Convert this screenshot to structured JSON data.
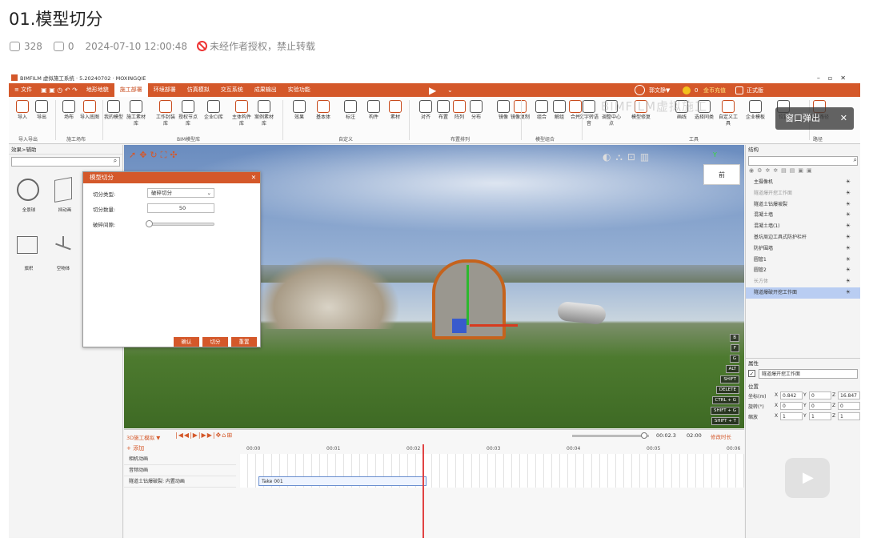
{
  "page": {
    "title": "01.模型切分",
    "views": "328",
    "comments": "0",
    "datetime": "2024-07-10 12:00:48",
    "notice": "未经作者授权，禁止转载"
  },
  "app": {
    "title": "BIMFILM 虚拟施工系统 · 5.20240702 · MOXINGQIE",
    "file_menu": "≡ 文件",
    "tabs": [
      "地形地貌",
      "施工部署",
      "环境部署",
      "仿真模拟",
      "交互系统",
      "成果输出",
      "实验功能"
    ],
    "active_tab": "施工部署",
    "user": "郭文静▼",
    "coins": "0",
    "recharge": "金币充值",
    "edition": "正式版"
  },
  "ribbon": {
    "buttons": [
      "导入",
      "导出",
      "场布",
      "导入底图",
      "我的模型",
      "施工素材库",
      "工作封装库",
      "授权节点库",
      "企业CI库",
      "主体构件库",
      "案例素材库",
      "效果",
      "基本体",
      "标注",
      "构件",
      "素材",
      "对齐",
      "布置",
      "阵列",
      "分布",
      "镜像",
      "镜像复制",
      "组合",
      "解组",
      "合并",
      "文字转语音",
      "调整中心点",
      "模型修复",
      "画线",
      "选择同类",
      "自定义工具",
      "企业模板",
      "位置",
      "测量路径"
    ],
    "groups": [
      "导入导出",
      "施工场布",
      "BIM模型库",
      "自定义",
      "布置排列",
      "模型组合",
      "工具",
      "路径"
    ]
  },
  "left_panel": {
    "header": "效果>辅助",
    "items": [
      "全景球",
      "挡动画",
      "旗帜",
      "空物体"
    ]
  },
  "dialog": {
    "title": "模型切分",
    "type_label": "切分类型:",
    "type_value": "破碎切分",
    "count_label": "切分数量:",
    "count_value": "50",
    "gap_label": "破碎间隙:",
    "gap_value": 0.0,
    "confirm": "确认",
    "split": "切分",
    "reset": "重置"
  },
  "overlay": {
    "popout": "窗口弹出",
    "watermark": "BIMFILM虚拟施工"
  },
  "viewport": {
    "view_label": "前",
    "axis_y": "Y",
    "shortcuts": [
      "B",
      "F",
      "G",
      "ALT",
      "SHIFT",
      "DELETE",
      "CTRL + G",
      "SHIFT + G",
      "SHIFT + T"
    ]
  },
  "right_panel": {
    "header": "结构",
    "items": [
      "主摄像机",
      "隧道爆开挖工作面",
      "隧道土钻爆坡裂",
      "混凝土墙",
      "混凝土墙(1)",
      "基坑周边工具式防护栏杆",
      "防护围墙",
      "圆管1",
      "圆管2",
      "长方体",
      "隧道爆破开挖工作面"
    ],
    "selected_index": 10,
    "props_header": "属性",
    "name_value": "隧道爆开挖工作面",
    "position_header": "位置",
    "coord_label": "坐标(m)",
    "rot_label": "旋转(°)",
    "scale_label": "缩放",
    "coord": {
      "x": "0.842",
      "y": "0",
      "z": "16.847"
    },
    "rot": {
      "x": "0",
      "y": "0",
      "z": "0"
    },
    "scale": {
      "x": "1",
      "y": "1",
      "z": "1"
    }
  },
  "timeline": {
    "mode": "3D施工模拟 ▼",
    "add": "+ 添加",
    "tracks": [
      "相机动画",
      "音频动画",
      "隧道土钻爆破裂: 内置动画"
    ],
    "ticks": [
      "00:00",
      "00:01",
      "00:02",
      "00:03",
      "00:04",
      "00:05",
      "00:06"
    ],
    "current": "00:02.3",
    "total": "02:00",
    "modify": "修改时长",
    "clip": "Take 001"
  }
}
